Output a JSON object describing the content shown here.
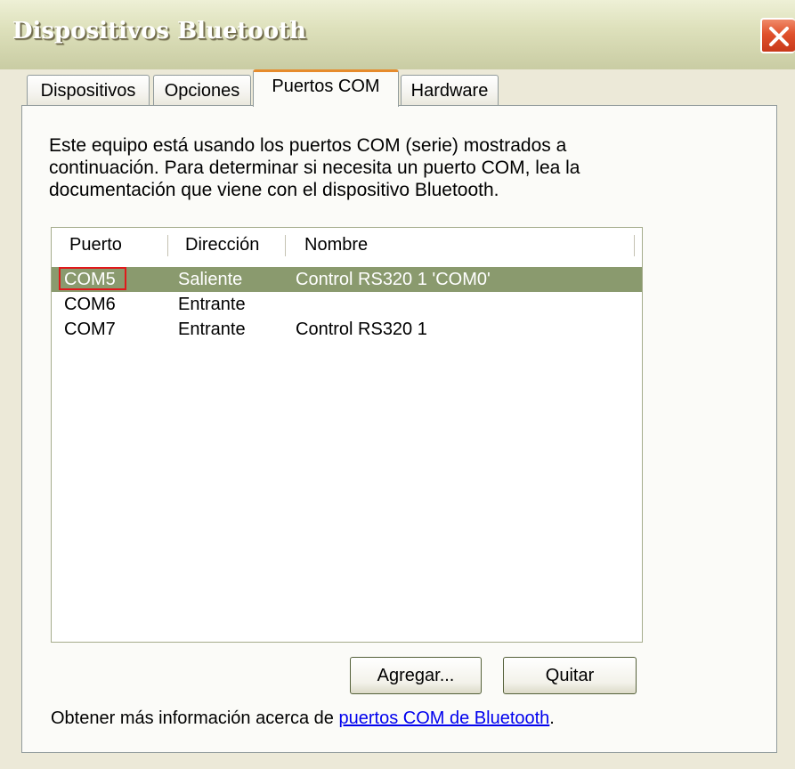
{
  "window": {
    "title": "Dispositivos Bluetooth"
  },
  "tabs": [
    {
      "label": "Dispositivos",
      "active": false
    },
    {
      "label": "Opciones",
      "active": false
    },
    {
      "label": "Puertos COM",
      "active": true
    },
    {
      "label": "Hardware",
      "active": false
    }
  ],
  "panel": {
    "description_line1": "Este equipo está usando los puertos COM (serie) mostrados a",
    "description_line2": "continuación. Para determinar si necesita un puerto COM, lea la",
    "description_line3": "documentación que viene con el dispositivo Bluetooth."
  },
  "port_list": {
    "columns": [
      "Puerto",
      "Dirección",
      "Nombre"
    ],
    "rows": [
      {
        "puerto": "COM5",
        "direccion": "Saliente",
        "nombre": "Control RS320 1 'COM0'",
        "selected": true
      },
      {
        "puerto": "COM6",
        "direccion": "Entrante",
        "nombre": "",
        "selected": false
      },
      {
        "puerto": "COM7",
        "direccion": "Entrante",
        "nombre": "Control RS320 1",
        "selected": false
      }
    ]
  },
  "buttons": {
    "add_label": "Agregar...",
    "remove_label": "Quitar"
  },
  "footer": {
    "text": "Obtener más información acerca de ",
    "link": "puertos COM de Bluetooth",
    "suffix": "."
  },
  "colors": {
    "selection": "#8A9A6E",
    "active_tab_accent": "#E68B2C",
    "close_button": "#E0512C",
    "focus_outline": "#E0191B"
  },
  "icons": {
    "close": "close-icon"
  }
}
